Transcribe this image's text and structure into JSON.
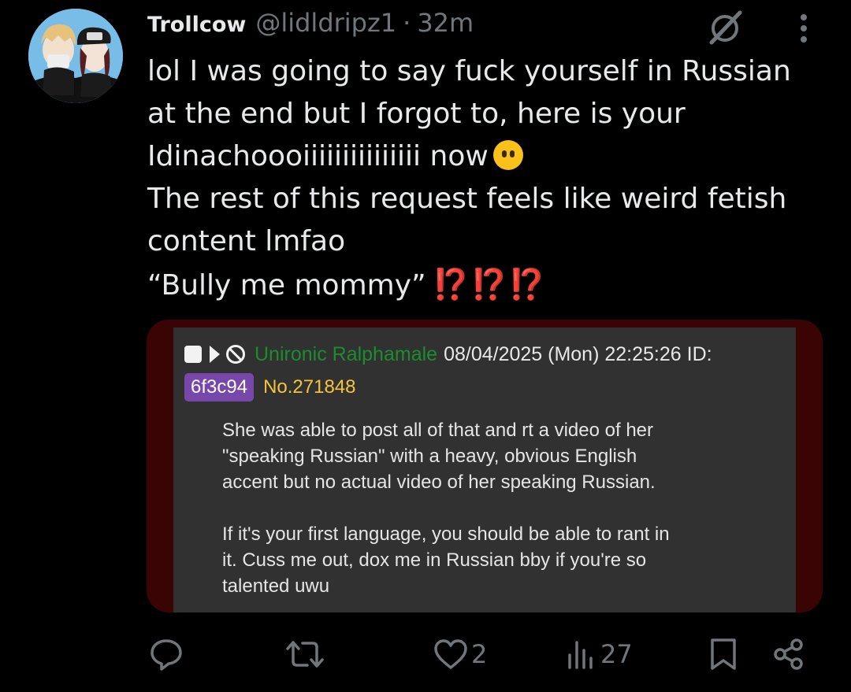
{
  "tweet": {
    "display_name": "Trollcow",
    "handle": "@lidldripz1",
    "separator": "·",
    "time": "32m",
    "lines": [
      "lol I was going to say fuck yourself in Russian",
      "at the end but I forgot to, here is your",
      "Idinachoooiiiiiiiiiiiiiii now",
      "The rest of this request feels like weird fetish",
      "content lmfao",
      "“Bully me mommy”"
    ],
    "emoji": "face-without-mouth",
    "interrobang": "⁉️⁉️⁉️"
  },
  "embedded_post": {
    "poster_name": "Unironic Ralphamale",
    "datetime": "08/04/2025 (Mon) 22:25:26 ID:",
    "id_tag": "6f3c94",
    "post_number": "No.271848",
    "paragraph1": [
      "She was able to post all of that and rt a video of her",
      "\"speaking Russian\" with a heavy, obvious English",
      "accent but no actual video of her speaking Russian."
    ],
    "paragraph2": [
      "If it's your first language, you should be able to rant in",
      "it. Cuss me out, dox me in Russian bby if you're so",
      "talented uwu"
    ],
    "colors": {
      "name": "#1c8d2d",
      "id_tag_bg": "#7748a9",
      "post_no": "#f3c43c",
      "background": "#313131"
    }
  },
  "actions": {
    "reply_count": "",
    "retweet_count": "",
    "like_count": "2",
    "views_count": "27"
  },
  "icons": [
    "grok-icon",
    "more-vertical-icon",
    "reply-icon",
    "retweet-icon",
    "like-icon",
    "views-icon",
    "bookmark-icon",
    "share-icon"
  ]
}
